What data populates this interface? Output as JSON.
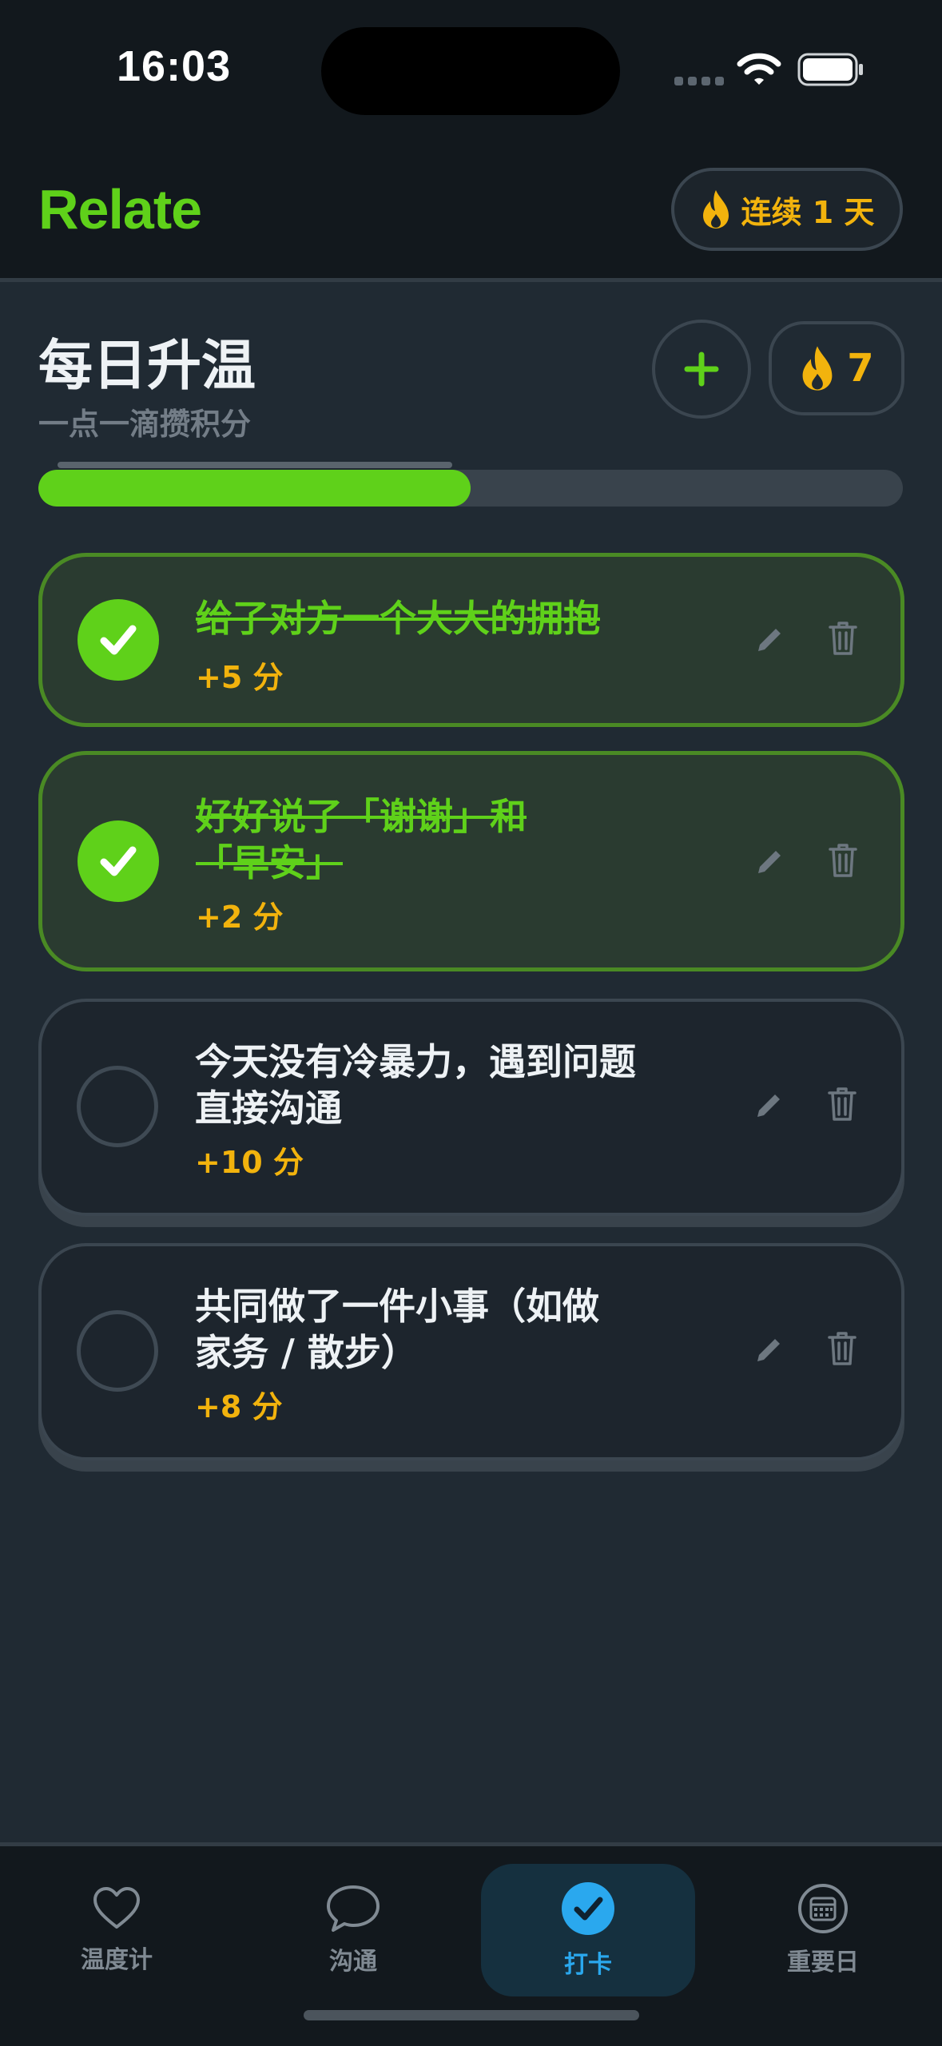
{
  "status_bar": {
    "time": "16:03"
  },
  "header": {
    "brand": "Relate",
    "streak_label": "连续 1 天"
  },
  "section": {
    "title": "每日升温",
    "subtitle": "一点一滴攒积分",
    "score": "7",
    "progress_fraction": 0.5
  },
  "tasks": [
    {
      "title": "给了对方一个大大的拥抱",
      "points": "+5 分",
      "done": true
    },
    {
      "title": "好好说了「谢谢」和「早安」",
      "points": "+2 分",
      "done": true
    },
    {
      "title": "今天没有冷暴力，遇到问题直接沟通",
      "points": "+10 分",
      "done": false
    },
    {
      "title": "共同做了一件小事（如做家务 / 散步）",
      "points": "+8 分",
      "done": false
    }
  ],
  "tabs": [
    {
      "label": "温度计",
      "icon": "heart-icon",
      "active": false
    },
    {
      "label": "沟通",
      "icon": "chat-bubble-icon",
      "active": false
    },
    {
      "label": "打卡",
      "icon": "check-circle-icon",
      "active": true
    },
    {
      "label": "重要日",
      "icon": "calendar-icon",
      "active": false
    }
  ],
  "colors": {
    "accent_green": "#5fd11a",
    "accent_yellow": "#f2b30d",
    "accent_blue": "#2aa8ee",
    "background": "#202a33"
  }
}
